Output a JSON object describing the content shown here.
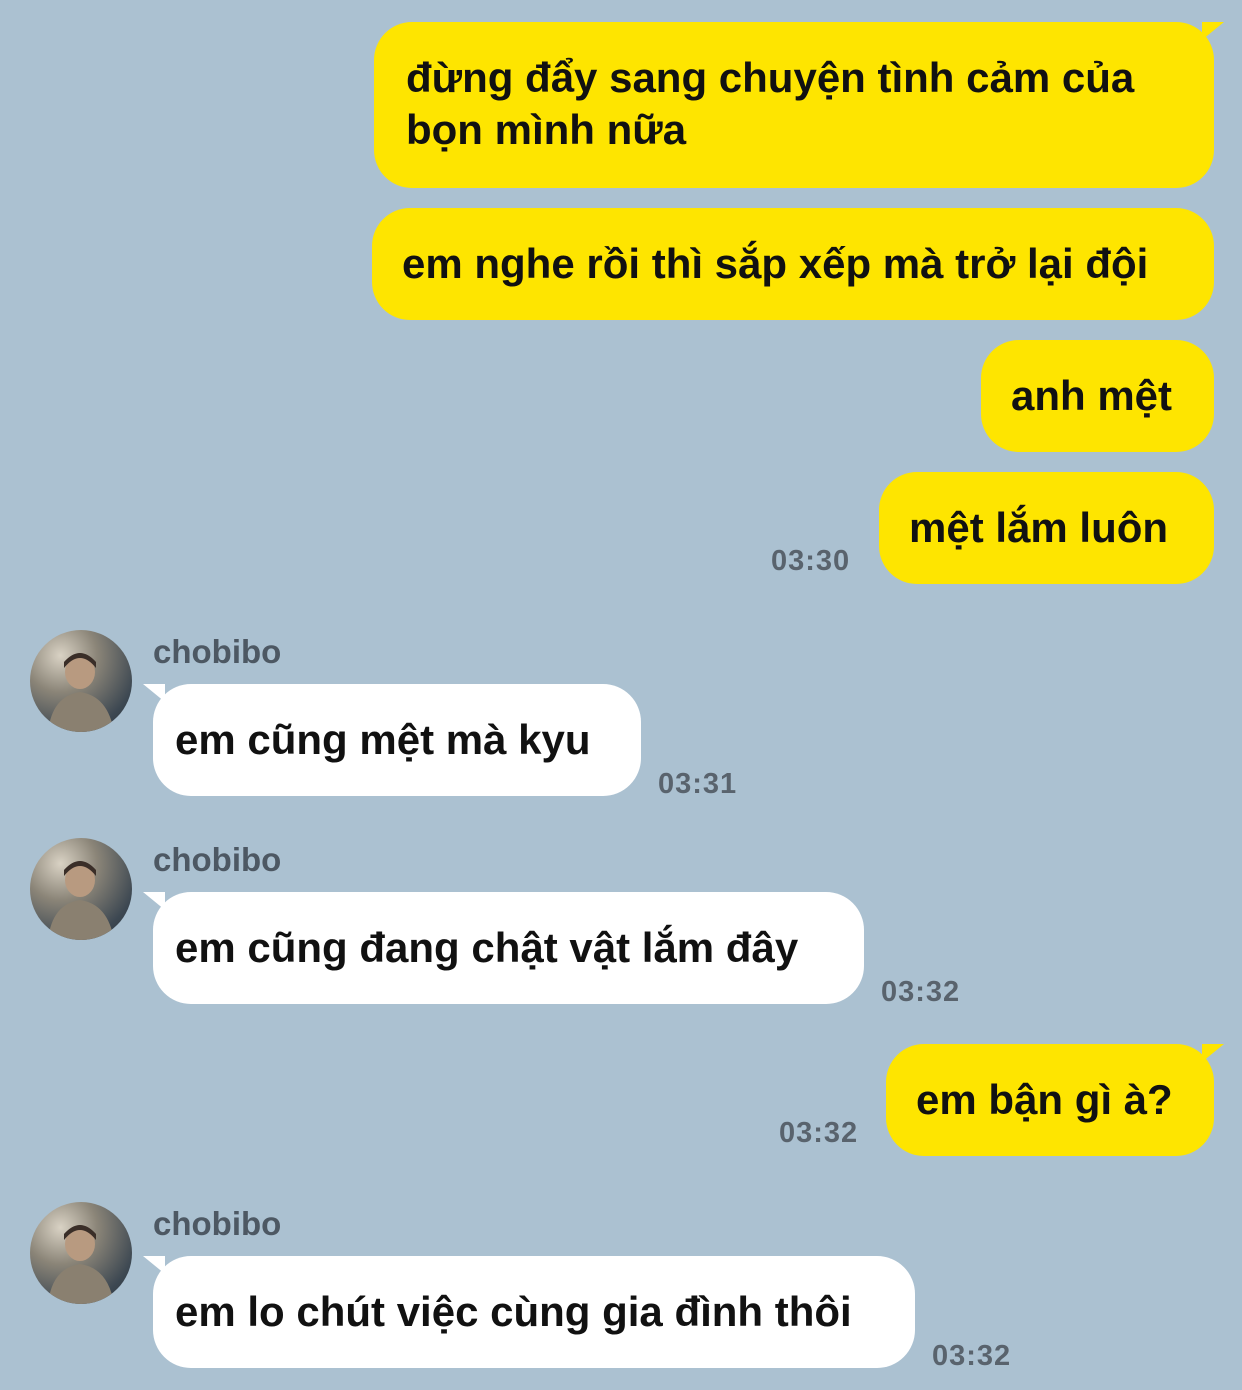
{
  "colors": {
    "background": "#abc1d1",
    "sent_bubble": "#fee500",
    "received_bubble": "#ffffff",
    "timestamp": "#59636d",
    "sender_name": "#4d5863"
  },
  "messages": [
    {
      "direction": "sent",
      "lines": [
        "đừng đẩy sang chuyện tình cảm của",
        "bọn mình nữa"
      ]
    },
    {
      "direction": "sent",
      "lines": [
        "em nghe rồi thì sắp xếp mà trở lại đội"
      ]
    },
    {
      "direction": "sent",
      "lines": [
        "anh mệt"
      ]
    },
    {
      "direction": "sent",
      "lines": [
        "mệt lắm luôn"
      ],
      "time": "03:30"
    },
    {
      "direction": "received",
      "sender": "chobibo",
      "avatar_icon": "profile-photo-avatar",
      "lines": [
        "em cũng mệt mà kyu"
      ],
      "time": "03:31"
    },
    {
      "direction": "received",
      "sender": "chobibo",
      "avatar_icon": "profile-photo-avatar",
      "lines": [
        "em cũng đang chật vật lắm đây"
      ],
      "time": "03:32"
    },
    {
      "direction": "sent",
      "lines": [
        "em bận gì à?"
      ],
      "time": "03:32"
    },
    {
      "direction": "received",
      "sender": "chobibo",
      "avatar_icon": "profile-photo-avatar",
      "lines": [
        "em lo chút việc cùng gia đình thôi"
      ],
      "time": "03:32"
    }
  ]
}
